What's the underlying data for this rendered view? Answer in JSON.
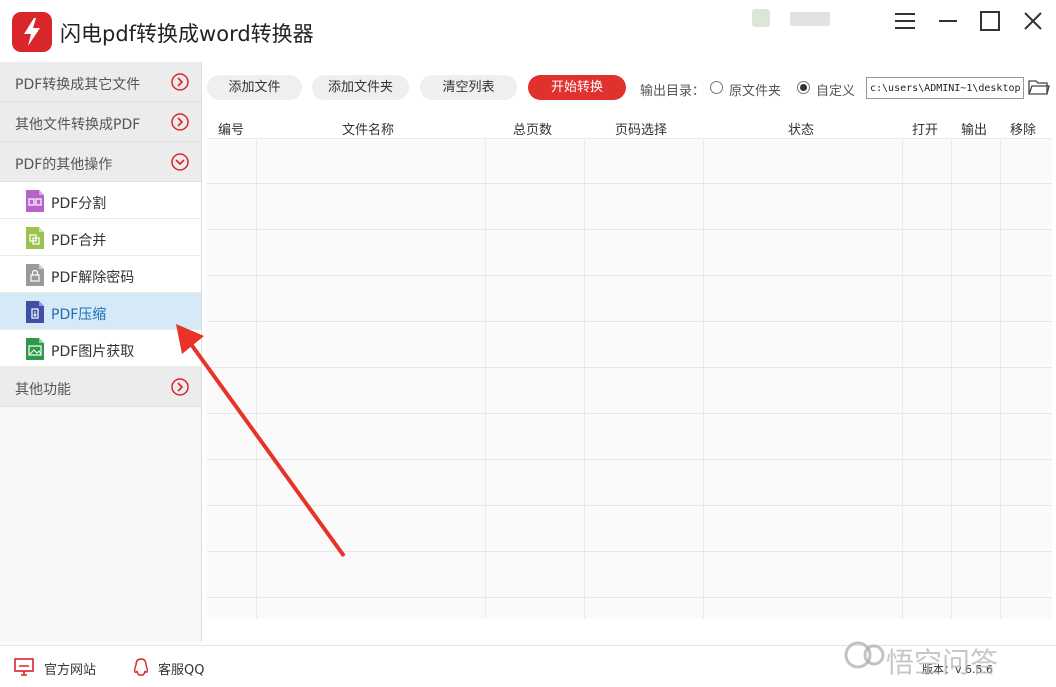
{
  "window": {
    "title": "闪电pdf转换成word转换器",
    "app_icon": "lightning-logo-icon",
    "controls": [
      "menu-icon",
      "minimize-icon",
      "maximize-icon",
      "close-icon"
    ]
  },
  "sidebar": {
    "groups": [
      {
        "label": "PDF转换成其它文件",
        "state": "collapsed"
      },
      {
        "label": "其他文件转换成PDF",
        "state": "collapsed"
      },
      {
        "label": "PDF的其他操作",
        "state": "expanded"
      },
      {
        "label": "其他功能",
        "state": "collapsed"
      }
    ],
    "items": [
      {
        "label": "PDF分割",
        "icon": "pdf-split-icon",
        "color": "#b763c9"
      },
      {
        "label": "PDF合并",
        "icon": "pdf-merge-icon",
        "color": "#9bc34f"
      },
      {
        "label": "PDF解除密码",
        "icon": "pdf-unlock-icon",
        "color": "#9a9a9a"
      },
      {
        "label": "PDF压缩",
        "icon": "pdf-compress-icon",
        "color": "#3f4fa6",
        "selected": true
      },
      {
        "label": "PDF图片获取",
        "icon": "pdf-image-icon",
        "color": "#2c9a49"
      }
    ]
  },
  "toolbar": {
    "add_file": "添加文件",
    "add_folder": "添加文件夹",
    "clear_list": "清空列表",
    "start": "开始转换",
    "output_label": "输出目录：",
    "option_original": "原文件夹",
    "option_custom": "自定义",
    "selected_option": "自定义",
    "output_path": "c:\\users\\ADMINI~1\\desktop"
  },
  "table": {
    "columns": [
      "编号",
      "文件名称",
      "总页数",
      "页码选择",
      "状态",
      "打开",
      "输出",
      "移除"
    ],
    "rows": []
  },
  "footer": {
    "website": "官方网站",
    "support": "客服QQ",
    "version": "版本：v 6.5.6"
  },
  "watermark": {
    "text": "悟空问答"
  },
  "colors": {
    "accent": "#e0312f",
    "selected_bg": "#d6e9f7",
    "annotation_arrow": "#e8332a"
  }
}
